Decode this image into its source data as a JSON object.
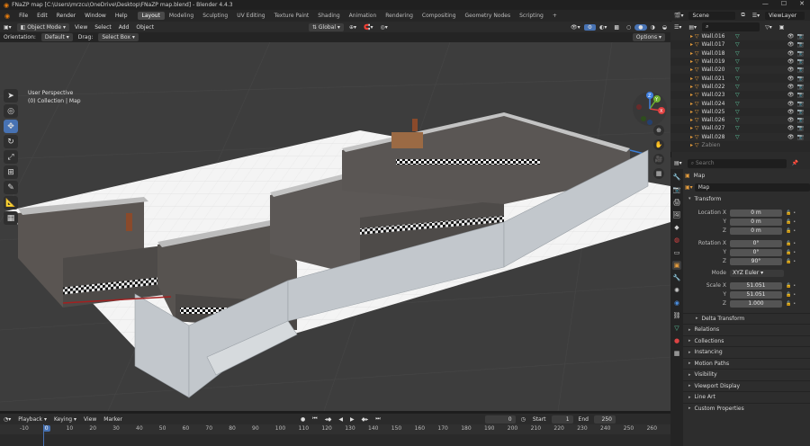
{
  "window": {
    "title": "FNaZP map [C:\\Users\\mrzcu\\OneDrive\\Desktop\\FNaZP map.blend] - Blender 4.4.3"
  },
  "menu": [
    "File",
    "Edit",
    "Render",
    "Window",
    "Help"
  ],
  "workspaces": [
    "Layout",
    "Modeling",
    "Sculpting",
    "UV Editing",
    "Texture Paint",
    "Shading",
    "Animation",
    "Rendering",
    "Compositing",
    "Geometry Nodes",
    "Scripting"
  ],
  "workspace_add": "+",
  "header": {
    "mode": "Object Mode",
    "view": "View",
    "select": "Select",
    "add": "Add",
    "object": "Object",
    "transform_orientation": "Global"
  },
  "header2": {
    "orientation_label": "Orientation:",
    "orientation_value": "Default",
    "drag_label": "Drag:",
    "drag_value": "Select Box",
    "options": "Options"
  },
  "viewport": {
    "perspective": "User Perspective",
    "collection": "(0) Collection | Map"
  },
  "gizmo": {
    "x": "X",
    "y": "Y",
    "z": "Z"
  },
  "timeline": {
    "playback": "Playback",
    "keying": "Keying",
    "view": "View",
    "marker": "Marker",
    "current_frame": "0",
    "start_label": "Start",
    "start": "1",
    "end_label": "End",
    "end": "250",
    "ticks": [
      "-10",
      "0",
      "10",
      "20",
      "30",
      "40",
      "50",
      "60",
      "70",
      "80",
      "90",
      "100",
      "110",
      "120",
      "130",
      "140",
      "150",
      "160",
      "170",
      "180",
      "190",
      "200",
      "210",
      "220",
      "230",
      "240",
      "250",
      "260"
    ]
  },
  "scene": {
    "scene_name": "Scene",
    "view_layer": "ViewLayer"
  },
  "outliner": {
    "items": [
      "Wall.016",
      "Wall.017",
      "Wall.018",
      "Wall.019",
      "Wall.020",
      "Wall.021",
      "Wall.022",
      "Wall.023",
      "Wall.024",
      "Wall.025",
      "Wall.026",
      "Wall.027",
      "Wall.028"
    ],
    "partial": "Zabien"
  },
  "properties": {
    "search_placeholder": "Search",
    "object_name": "Map",
    "data_name": "Map",
    "transform_title": "Transform",
    "location": {
      "label": "Location X",
      "x": "0 m",
      "y": "0 m",
      "z": "0 m"
    },
    "rotation": {
      "label": "Rotation X",
      "x": "0°",
      "y": "0°",
      "z": "90°"
    },
    "mode": {
      "label": "Mode",
      "value": "XYZ Euler"
    },
    "scale": {
      "label": "Scale X",
      "x": "51.051",
      "y": "51.051",
      "z": "1.000"
    },
    "axis_y": "Y",
    "axis_z": "Z",
    "delta": "Delta Transform",
    "sections": [
      "Relations",
      "Collections",
      "Instancing",
      "Motion Paths",
      "Visibility",
      "Viewport Display",
      "Line Art",
      "Custom Properties"
    ]
  },
  "colors": {
    "accent": "#4772b3",
    "active_tab": "#4a4a4a",
    "object_orange": "#e39b3c",
    "mesh_green": "#5fc9a0"
  }
}
